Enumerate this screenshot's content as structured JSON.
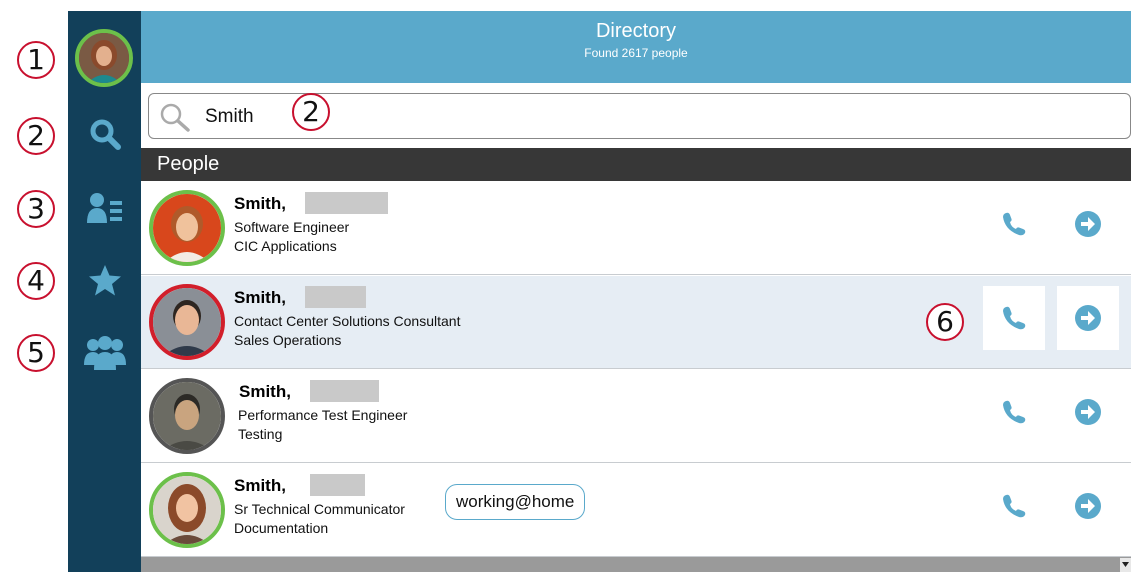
{
  "callouts": [
    "1",
    "2",
    "3",
    "4",
    "5",
    "2",
    "6"
  ],
  "header": {
    "title": "Directory",
    "subtitle": "Found 2617 people"
  },
  "search": {
    "value": "Smith"
  },
  "section": {
    "label": "People"
  },
  "sidebar": {
    "items": [
      {
        "name": "search-icon"
      },
      {
        "name": "contacts-list-icon"
      },
      {
        "name": "star-icon"
      },
      {
        "name": "groups-icon"
      }
    ]
  },
  "people": [
    {
      "name": "Smith,",
      "title": "Software Engineer",
      "department": "CIC Applications",
      "status": "available",
      "selected": false
    },
    {
      "name": "Smith,",
      "title": "Contact Center Solutions Consultant",
      "department": "Sales Operations",
      "status": "busy",
      "selected": true
    },
    {
      "name": "Smith,",
      "title": "Performance Test Engineer",
      "department": "Testing",
      "status": "unknown",
      "selected": false
    },
    {
      "name": "Smith,",
      "title": "Sr Technical Communicator",
      "department": "Documentation",
      "status": "available",
      "status_message": "working@home",
      "selected": false
    }
  ],
  "colors": {
    "sidebar": "#12405a",
    "header": "#5aa9cb",
    "available": "#6cc04a",
    "busy": "#d21f2b",
    "action_icon": "#5aa9cb",
    "callout_border": "#c8102e"
  }
}
